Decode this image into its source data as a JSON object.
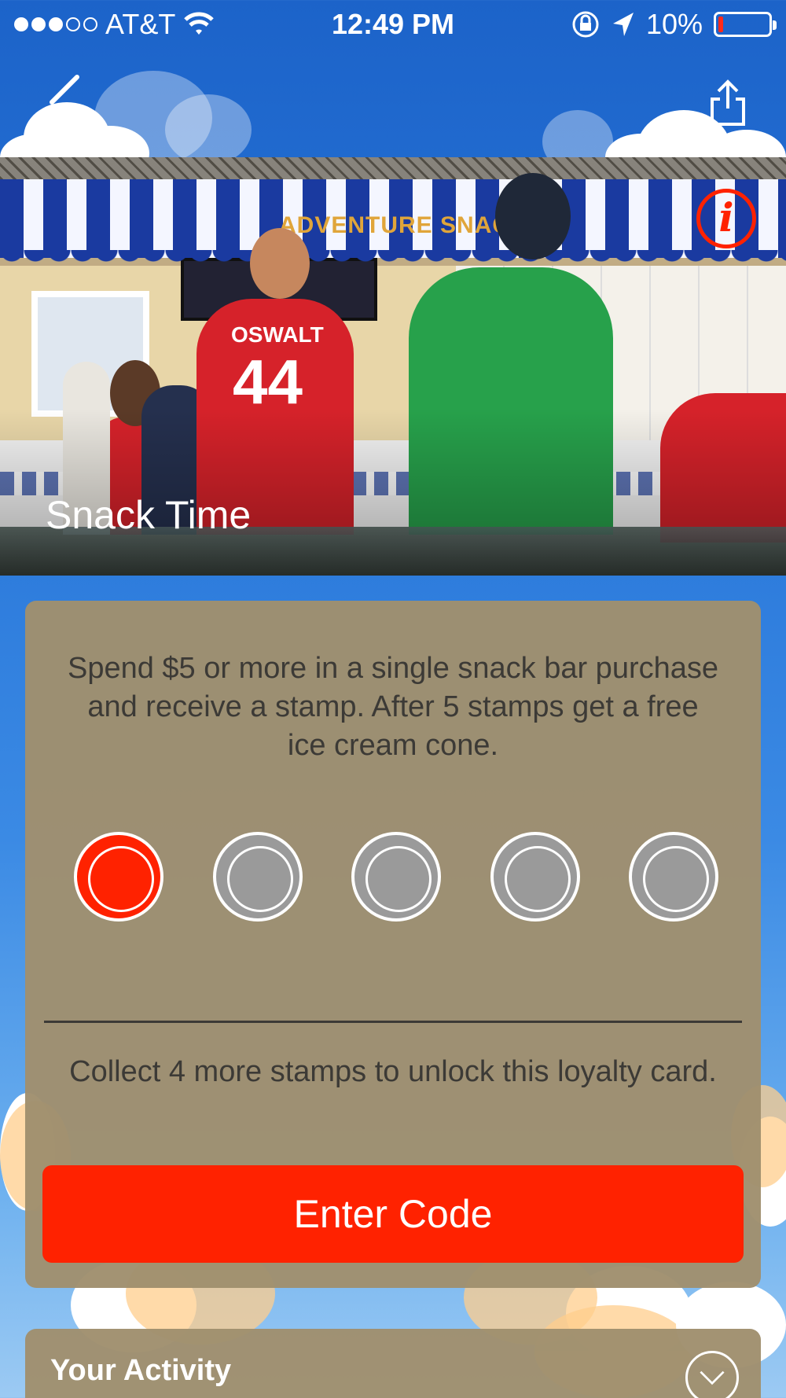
{
  "status_bar": {
    "carrier": "AT&T",
    "time": "12:49 PM",
    "battery": "10%",
    "battery_level": 0.1,
    "signal_bars_filled": 3,
    "signal_bars_total": 5
  },
  "nav": {
    "back_icon": "back-arrow-icon",
    "share_icon": "share-icon"
  },
  "hero": {
    "title": "Snack Time",
    "sign_text": "ADVENTURE SNACK",
    "jersey_name": "OSWALT",
    "jersey_number": "44",
    "info_label": "i"
  },
  "card": {
    "description": "Spend $5 or more in a single snack bar purchase and receive a stamp. After 5 stamps get a free ice cream cone.",
    "stamps_total": 5,
    "stamps_collected": 1,
    "status_text": "Collect 4 more stamps to unlock this loyalty card.",
    "button_label": "Enter Code"
  },
  "activity": {
    "title": "Your Activity"
  },
  "colors": {
    "accent": "#ff2200",
    "card_bg": "#a0906e",
    "sky": "#2a78da"
  }
}
